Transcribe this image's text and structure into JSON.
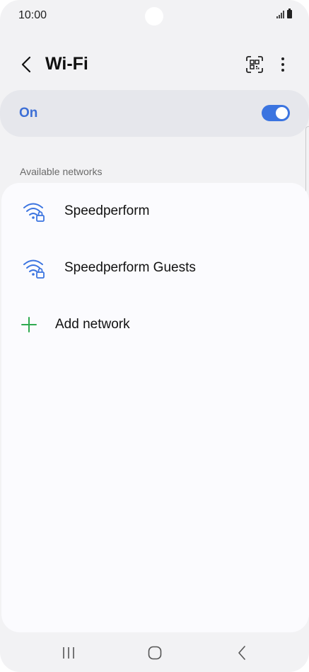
{
  "status_bar": {
    "time": "10:00",
    "signal_icon": "signal-icon",
    "battery_icon": "battery-icon"
  },
  "header": {
    "title": "Wi-Fi",
    "back_icon": "chevron-left-icon",
    "qr_icon": "qr-code-scan-icon",
    "more_icon": "more-vertical-icon"
  },
  "master_switch": {
    "label": "On",
    "enabled": true,
    "accent_color": "#3b74e0",
    "label_color": "#3d6fd6"
  },
  "available_networks": {
    "header": "Available networks",
    "items": [
      {
        "name": "Speedperform",
        "icon": "wifi-secured-icon"
      },
      {
        "name": "Speedperform Guests",
        "icon": "wifi-secured-icon"
      }
    ],
    "add_network": {
      "label": "Add network",
      "icon": "plus-icon",
      "color": "#2eaa4f"
    }
  },
  "navigation_bar": {
    "recents_icon": "recents-icon",
    "home_icon": "home-icon",
    "back_icon": "back-icon"
  }
}
